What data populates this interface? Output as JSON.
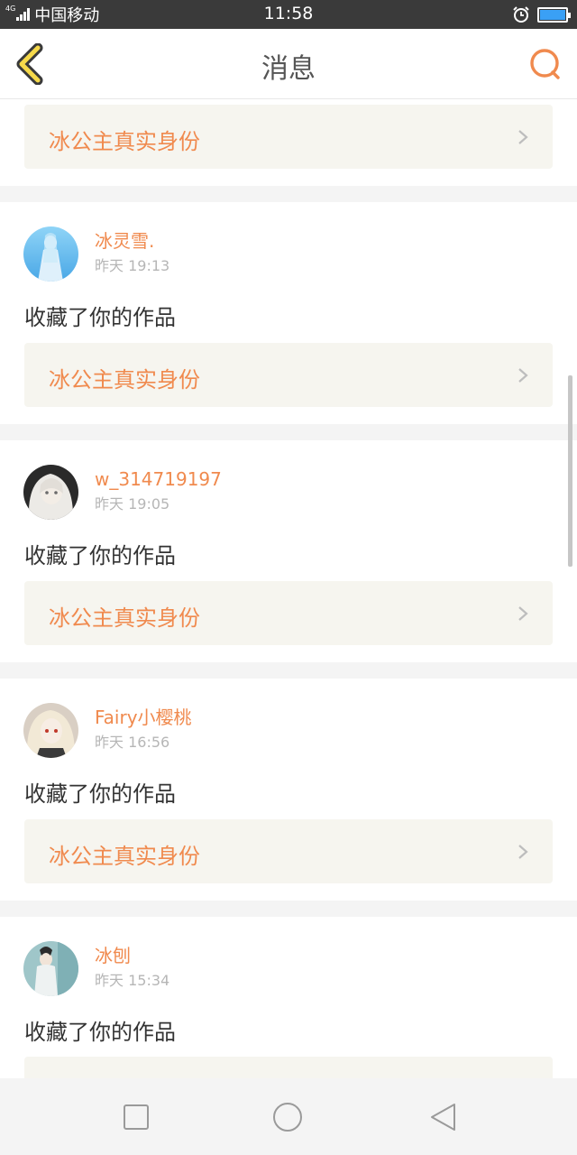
{
  "status_bar": {
    "network_type": "4G",
    "carrier": "中国移动",
    "time": "11:58",
    "icons": [
      "signal-icon",
      "alarm-icon",
      "battery-icon"
    ],
    "battery_level": 1.0
  },
  "header": {
    "title": "消息",
    "back_icon": "chevron-left-icon",
    "search_icon": "search-icon"
  },
  "colors": {
    "accent": "#f08a4e",
    "back_icon_fill": "#f6d94a",
    "card_bg": "#ffffff",
    "link_bg": "#f6f5ef",
    "separator": "#f4f4f4",
    "status_bar_bg": "#3a3a3a",
    "battery_fill": "#3aa0f5"
  },
  "messages": [
    {
      "user": "",
      "time": "",
      "action": "",
      "work_title": "冰公主真实身份"
    },
    {
      "user": "冰灵雪.",
      "time": "昨天 19:13",
      "action": "收藏了你的作品",
      "work_title": "冰公主真实身份"
    },
    {
      "user": "w_314719197",
      "time": "昨天 19:05",
      "action": "收藏了你的作品",
      "work_title": "冰公主真实身份"
    },
    {
      "user": "Fairy小樱桃",
      "time": "昨天 16:56",
      "action": "收藏了你的作品",
      "work_title": "冰公主真实身份"
    },
    {
      "user": "冰刨",
      "time": "昨天 15:34",
      "action": "收藏了你的作品",
      "work_title": ""
    }
  ],
  "nav_bar": {
    "icons": [
      "recent-apps-icon",
      "home-icon",
      "back-triangle-icon"
    ]
  }
}
